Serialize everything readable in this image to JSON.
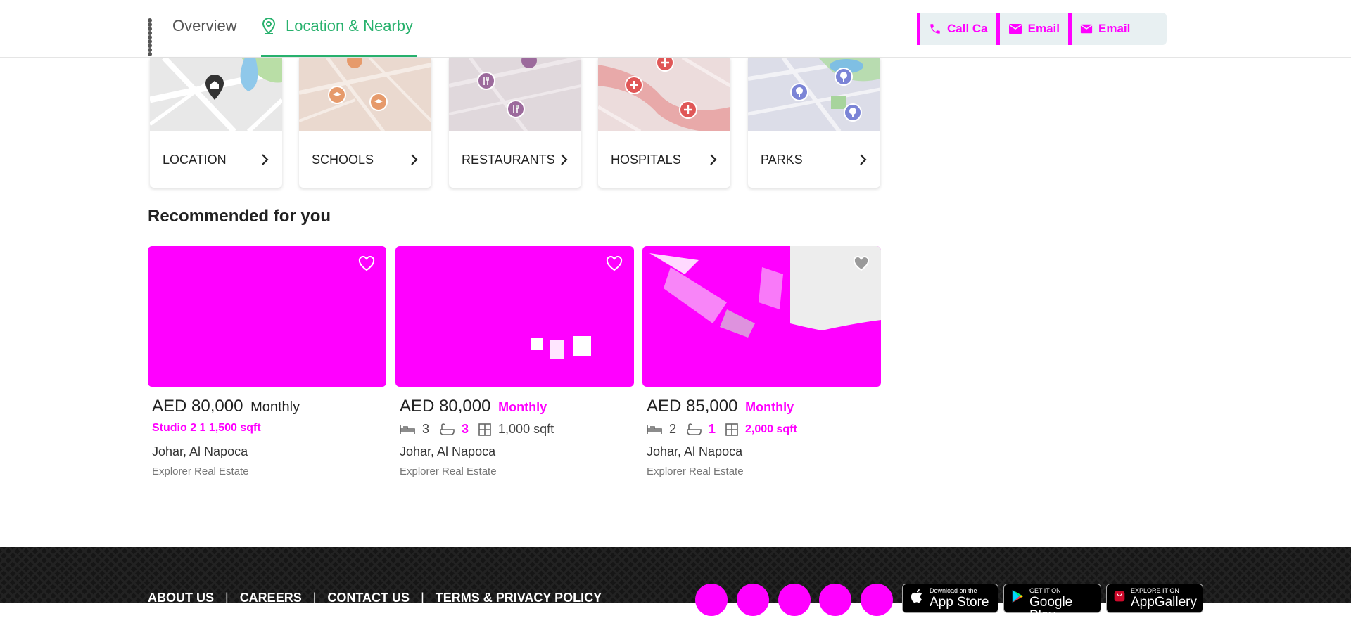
{
  "header": {
    "tabs": [
      {
        "label": "Overview",
        "icon": "grid-icon",
        "active": false
      },
      {
        "label": "Location & Nearby",
        "icon": "location-pin-icon",
        "active": true
      }
    ],
    "contact": {
      "call_label": "Call Ca",
      "email_label": "Email",
      "whatsapp_label": "Email"
    }
  },
  "nearby": [
    {
      "label": "LOCATION",
      "icon": "home-pin-icon"
    },
    {
      "label": "SCHOOLS",
      "icon": "school-icon"
    },
    {
      "label": "RESTAURANTS",
      "icon": "restaurant-icon"
    },
    {
      "label": "HOSPITALS",
      "icon": "hospital-icon"
    },
    {
      "label": "PARKS",
      "icon": "park-icon"
    }
  ],
  "recommended": {
    "title": "Recommended for you",
    "listings": [
      {
        "price": "AED 80,000",
        "frequency": "Monthly",
        "specs_text": "Studio 2 1 1,500 sqft",
        "location": "Johar, Al Napoca",
        "agent": "Explorer Real Estate"
      },
      {
        "price": "AED 80,000",
        "frequency": "Monthly",
        "beds": "3",
        "baths": "3",
        "area": "1,000 sqft",
        "location": "Johar, Al Napoca",
        "agent": "Explorer Real Estate"
      },
      {
        "price": "AED 85,000",
        "frequency": "Monthly",
        "beds": "2",
        "baths": "1",
        "area": "2,000 sqft",
        "location": "Johar, Al Napoca",
        "agent": "Explorer Real Estate"
      }
    ]
  },
  "footer": {
    "links": [
      "ABOUT US",
      "CAREERS",
      "CONTACT US",
      "TERMS & PRIVACY POLICY"
    ],
    "stores": [
      {
        "small": "Download on the",
        "big": "App Store",
        "icon": "apple-icon"
      },
      {
        "small": "GET IT ON",
        "big": "Google Play",
        "icon": "google-play-icon"
      },
      {
        "small": "EXPLORE IT ON",
        "big": "AppGallery",
        "icon": "huawei-icon"
      }
    ]
  },
  "colors": {
    "accent": "#28b16d",
    "placeholder": "#ff00ff",
    "footer_bg": "#161616"
  }
}
